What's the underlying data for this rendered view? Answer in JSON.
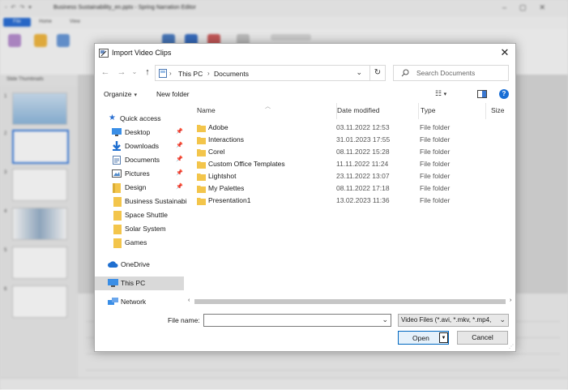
{
  "background_app": {
    "title": "Business Sustainability_en.pptx - Spring Narration Editor",
    "ribbon_tabs": [
      "File",
      "Home",
      "View"
    ],
    "panel_title": "Slide Thumbnails",
    "slide_numbers": [
      "1",
      "2",
      "3",
      "4",
      "5",
      "6"
    ]
  },
  "dialog": {
    "title": "Import Video Clips",
    "close_label": "✕",
    "address": {
      "crumbs": [
        "This PC",
        "Documents"
      ]
    },
    "search_placeholder": "Search Documents",
    "toolbar": {
      "organize": "Organize",
      "new_folder": "New folder",
      "help": "?"
    },
    "nav": {
      "quick_access": "Quick access",
      "pinned": [
        {
          "label": "Desktop",
          "icon": "desktop-icon"
        },
        {
          "label": "Downloads",
          "icon": "download-icon"
        },
        {
          "label": "Documents",
          "icon": "document-icon"
        },
        {
          "label": "Pictures",
          "icon": "pictures-icon"
        },
        {
          "label": "Design",
          "icon": "folder-icon"
        }
      ],
      "folders": [
        "Business Sustainabi",
        "Space Shuttle",
        "Solar System",
        "Games"
      ],
      "onedrive": "OneDrive",
      "this_pc": "This PC",
      "network": "Network"
    },
    "columns": {
      "name": "Name",
      "date_modified": "Date modified",
      "type": "Type",
      "size": "Size"
    },
    "files": [
      {
        "name": "Adobe",
        "date": "03.11.2022 12:53",
        "type": "File folder"
      },
      {
        "name": "Interactions",
        "date": "31.01.2023 17:55",
        "type": "File folder"
      },
      {
        "name": "Corel",
        "date": "08.11.2022 15:28",
        "type": "File folder"
      },
      {
        "name": "Custom Office Templates",
        "date": "11.11.2022 11:24",
        "type": "File folder"
      },
      {
        "name": "Lightshot",
        "date": "23.11.2022 13:07",
        "type": "File folder"
      },
      {
        "name": "My Palettes",
        "date": "08.11.2022 17:18",
        "type": "File folder"
      },
      {
        "name": "Presentation1",
        "date": "13.02.2023 11:36",
        "type": "File folder"
      }
    ],
    "file_name_label": "File name:",
    "file_name_value": "",
    "filter_value": "Video Files (*.avi, *.mkv, *.mp4,",
    "open_label": "Open",
    "cancel_label": "Cancel",
    "colors": {
      "accent": "#0067c0",
      "folder": "#f3c54b",
      "selection": "#d9d9d9"
    }
  }
}
